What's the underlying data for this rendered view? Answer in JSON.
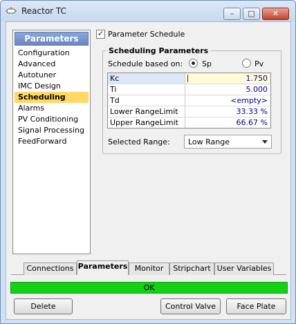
{
  "window": {
    "title": "Reactor TC",
    "controls": {
      "minimize": "–",
      "maximize": "□",
      "close": "✕"
    }
  },
  "sidebar": {
    "header": "Parameters",
    "items": [
      {
        "label": "Configuration"
      },
      {
        "label": "Advanced"
      },
      {
        "label": "Autotuner"
      },
      {
        "label": "IMC Design"
      },
      {
        "label": "Scheduling",
        "selected": true
      },
      {
        "label": "Alarms"
      },
      {
        "label": "PV Conditioning"
      },
      {
        "label": "Signal Processing"
      },
      {
        "label": "FeedForward"
      }
    ]
  },
  "main": {
    "parameter_schedule": {
      "label": "Parameter Schedule",
      "checked": true
    },
    "group_title": "Scheduling Parameters",
    "schedule_based_on": {
      "label": "Schedule based on:",
      "options": [
        {
          "label": "Sp",
          "selected": true
        },
        {
          "label": "Pv",
          "selected": false
        }
      ]
    },
    "grid": [
      {
        "name": "Kc",
        "value": "1.750"
      },
      {
        "name": "Ti",
        "value": "5.000"
      },
      {
        "name": "Td",
        "value": "<empty>"
      },
      {
        "name": "Lower RangeLimit",
        "value": "33.33 %"
      },
      {
        "name": "Upper RangeLimit",
        "value": "66.67 %"
      }
    ],
    "selected_range": {
      "label": "Selected Range:",
      "value": "Low Range"
    }
  },
  "tabs": [
    {
      "label": "Connections"
    },
    {
      "label": "Parameters",
      "active": true
    },
    {
      "label": "Monitor"
    },
    {
      "label": "Stripchart"
    },
    {
      "label": "User Variables"
    }
  ],
  "status": {
    "text": "OK",
    "color": "#15d015"
  },
  "buttons": {
    "delete": "Delete",
    "control_valve": "Control Valve",
    "face_plate": "Face Plate"
  },
  "colors": {
    "selection": "#ffd866",
    "sidebar_header": "#7b96cf",
    "value_text": "#00008b"
  }
}
